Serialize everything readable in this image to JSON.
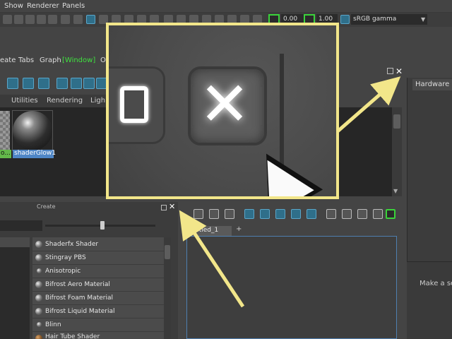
{
  "menubar": {
    "items": [
      "Show",
      "Renderer",
      "Panels"
    ]
  },
  "toolbar": {
    "value_1": "0.00",
    "value_2": "1.00",
    "color_space": "sRGB gamma",
    "color_space_arrow": "▼"
  },
  "hypershade_menu": {
    "items": [
      "eate",
      "Tabs",
      "Graph",
      "[Window]",
      "O"
    ]
  },
  "hypershade_tabs": [
    "Utilities",
    "Rendering",
    "Ligh"
  ],
  "swatches": {
    "item_1_label": "o...",
    "item_2_label": "shaderGlow1"
  },
  "right_panel": {
    "tab_label": "Hardware",
    "hint_text": "Make a sele"
  },
  "create_panel": {
    "title": "Create",
    "shaders": [
      "Shaderfx Shader",
      "Stingray PBS",
      "Anisotropic",
      "Bifrost Aero Material",
      "Bifrost Foam Material",
      "Bifrost Liquid Material",
      "Blinn",
      "Hair Tube Shader"
    ]
  },
  "graph_panel": {
    "tab_label": "ntitled_1",
    "add_tab": "+"
  },
  "glyphs": {
    "close": "✕",
    "scroll_down": "▼"
  },
  "colors": {
    "callout_border": "#f2e68a",
    "arrow": "#f2e68a",
    "selection_green": "#3ad33a",
    "selection_blue": "#4f86c6"
  },
  "icons": [
    "float-window-icon",
    "close-icon",
    "mouse-cursor-icon",
    "shader-ball-icon"
  ]
}
